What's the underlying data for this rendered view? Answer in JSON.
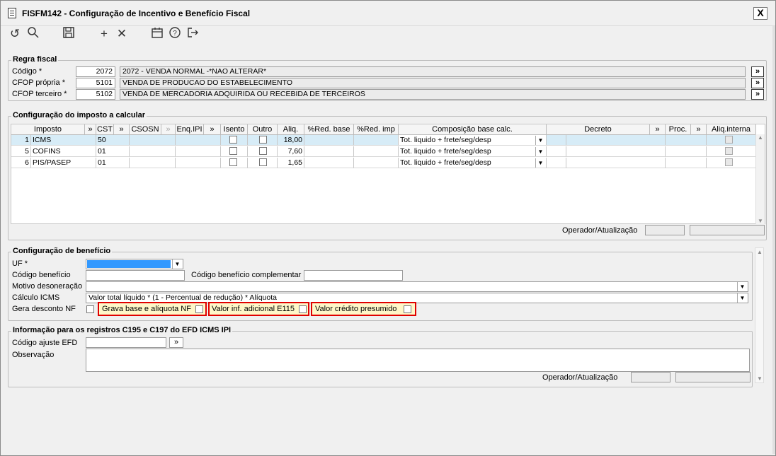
{
  "window": {
    "title": "FISFM142 - Configuração de Incentivo e Benefício Fiscal",
    "close_label": "X"
  },
  "toolbar": {
    "icons": [
      "refresh-icon",
      "search-icon",
      "save-icon",
      "add-icon",
      "delete-icon",
      "calendar-icon",
      "help-icon",
      "exit-icon"
    ]
  },
  "regra": {
    "title": "Regra fiscal",
    "codigo_label": "Código *",
    "codigo_value": "2072",
    "codigo_desc": "2072 - VENDA NORMAL -*NAO ALTERAR*",
    "cfop_propria_label": "CFOP própria *",
    "cfop_propria_value": "5101",
    "cfop_propria_desc": "VENDA DE PRODUCAO DO ESTABELECIMENTO",
    "cfop_terceiro_label": "CFOP terceiro *",
    "cfop_terceiro_value": "5102",
    "cfop_terceiro_desc": "VENDA DE MERCADORIA ADQUIRIDA OU RECEBIDA DE TERCEIROS",
    "lookup": "»"
  },
  "imposto": {
    "title": "Configuração do imposto a calcular",
    "headers": {
      "imposto": "Imposto",
      "cst": "CST",
      "csosn": "CSOSN",
      "enq": "Enq.IPI",
      "isento": "Isento",
      "outro": "Outro",
      "aliq": "Aliq.",
      "redbase": "%Red. base",
      "redimp": "%Red. imp",
      "comp": "Composição base calc.",
      "decreto": "Decreto",
      "proc": "Proc.",
      "aliqint": "Aliq.interna",
      "lookup": "»"
    },
    "rows": [
      {
        "n": "1",
        "imposto": "ICMS",
        "cst": "50",
        "aliq": "18,00",
        "comp": "Tot. liquido + frete/seg/desp"
      },
      {
        "n": "5",
        "imposto": "COFINS",
        "cst": "01",
        "aliq": "7,60",
        "comp": "Tot. liquido + frete/seg/desp"
      },
      {
        "n": "6",
        "imposto": "PIS/PASEP",
        "cst": "01",
        "aliq": "1,65",
        "comp": "Tot. liquido + frete/seg/desp"
      }
    ],
    "operador_label": "Operador/Atualização"
  },
  "beneficio": {
    "title": "Configuração de benefício",
    "uf_label": "UF *",
    "codigo_label": "Código benefício",
    "codigo_comp_label": "Código benefício complementar",
    "motivo_label": "Motivo desoneração",
    "calculo_label": "Cálculo ICMS",
    "calculo_value": "Valor total líquido * (1 - Percentual de redução) * Alíquota",
    "gera_label": "Gera desconto NF",
    "grava_label": "Grava base e alíquota NF",
    "valor_inf_label": "Valor inf. adicional E115",
    "valor_cred_label": "Valor crédito presumido"
  },
  "info": {
    "title": "Informação para os registros C195 e C197 do EFD ICMS IPI",
    "codigo_label": "Código ajuste EFD",
    "obs_label": "Observação",
    "operador_label": "Operador/Atualização",
    "lookup": "»"
  },
  "colors": {
    "selected_row": "#d7ecf7",
    "highlight_border": "#e00000",
    "highlight_fill": "#fff7c8",
    "uf_selected": "#3399ff"
  }
}
